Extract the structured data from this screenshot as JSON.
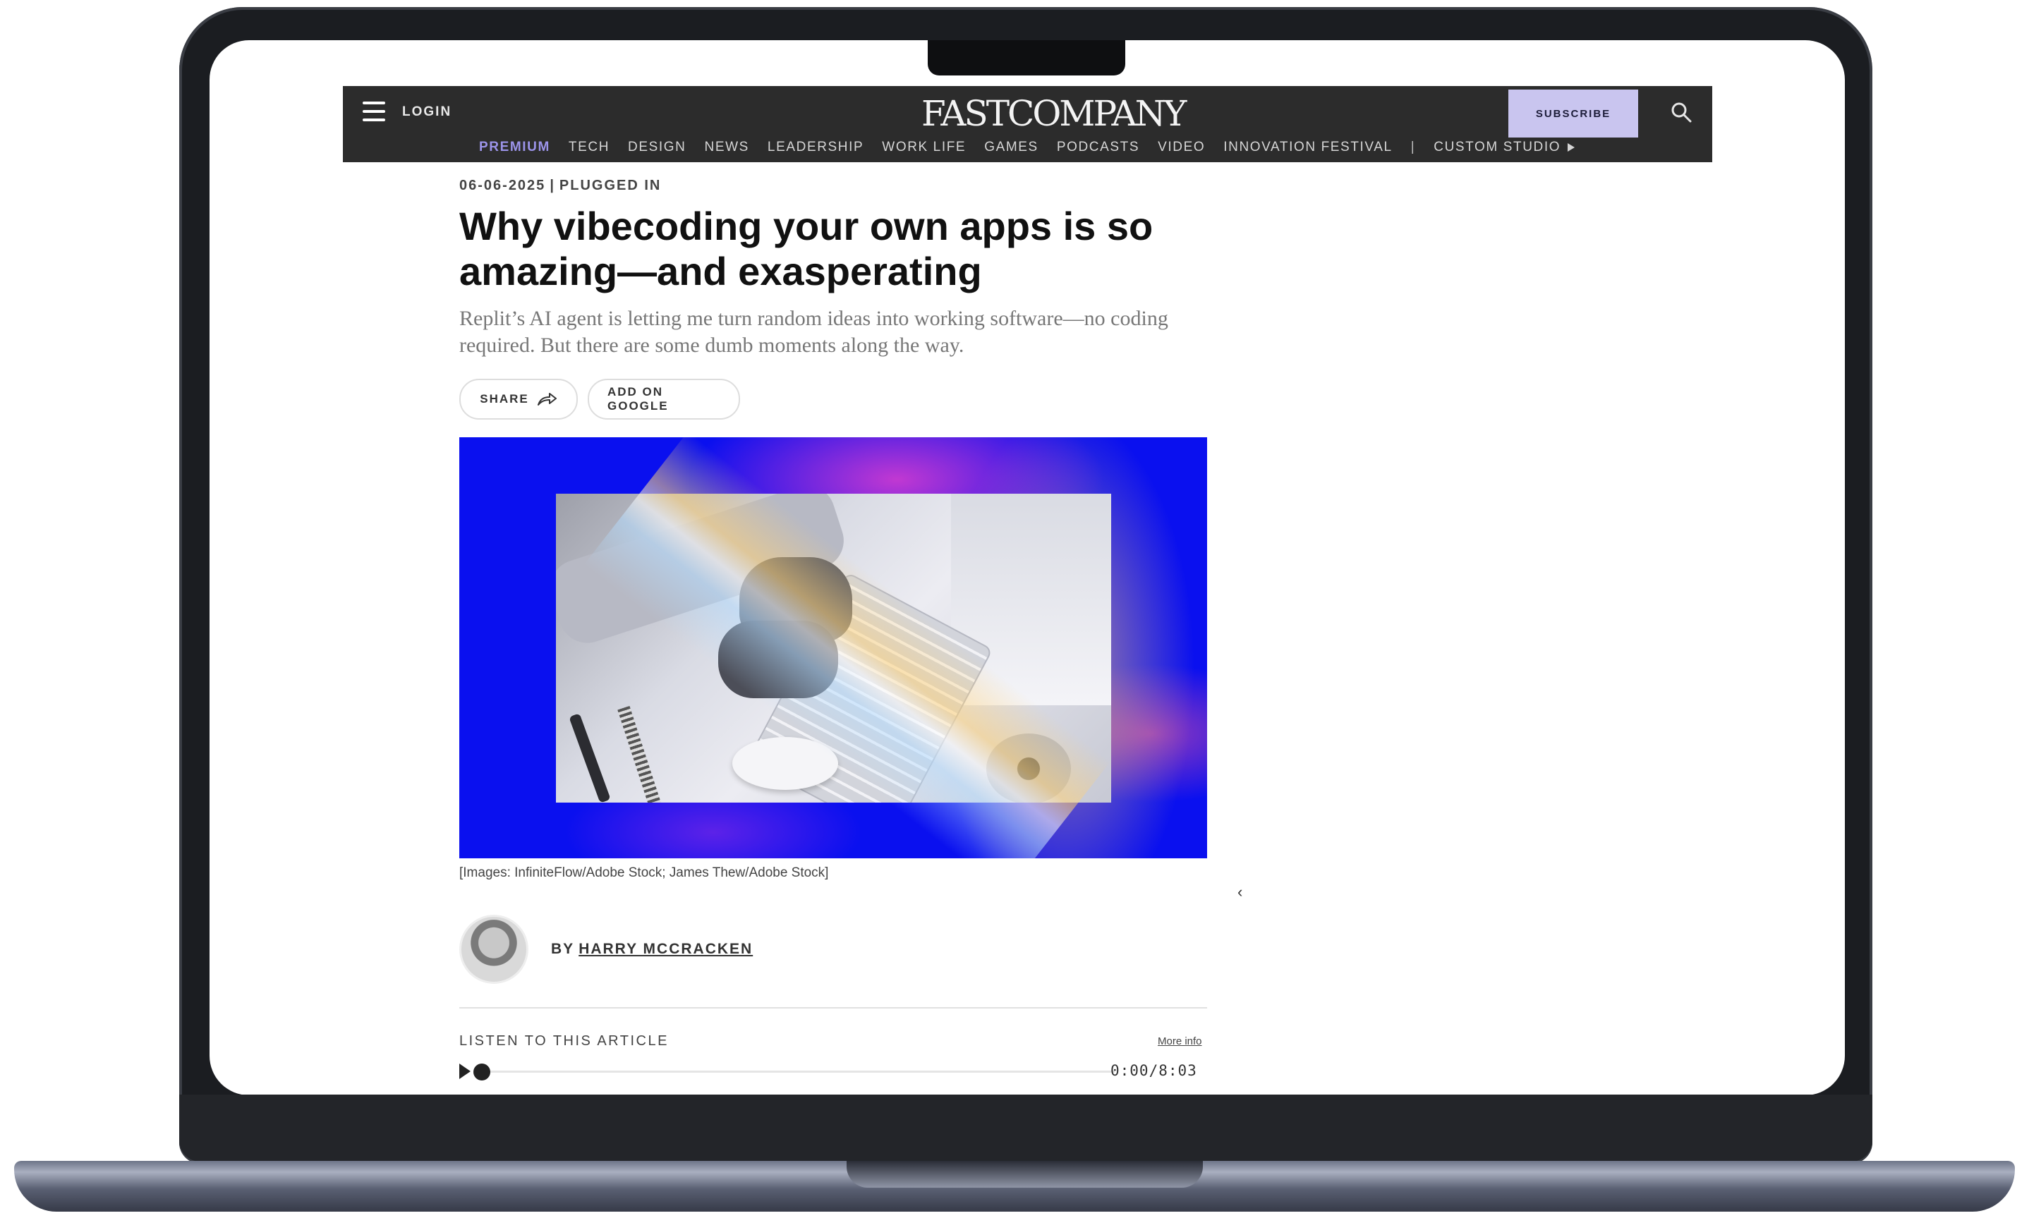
{
  "header": {
    "login_label": "LOGIN",
    "logo_text": "FASTCOMPANY",
    "subscribe_label": "SUBSCRIBE"
  },
  "nav": {
    "items": [
      "PREMIUM",
      "TECH",
      "DESIGN",
      "NEWS",
      "LEADERSHIP",
      "WORK LIFE",
      "GAMES",
      "PODCASTS",
      "VIDEO",
      "INNOVATION FESTIVAL"
    ],
    "separator": "|",
    "custom_studio": "CUSTOM STUDIO"
  },
  "article": {
    "date": "06-06-2025",
    "separator": "|",
    "section": "PLUGGED IN",
    "headline": "Why vibecoding your own apps is so amazing—and exasperating",
    "dek": "Replit’s AI agent is letting me turn random ideas into working software—no coding required. But there are some dumb moments along the way.",
    "share_label": "SHARE",
    "google_label": "ADD ON GOOGLE",
    "caption": "[Images: InfiniteFlow/Adobe Stock; James Thew/Adobe Stock]",
    "byline_prefix": "BY",
    "author": "HARRY MCCRACKEN"
  },
  "audio": {
    "label": "LISTEN TO THIS ARTICLE",
    "more_info": "More info",
    "time": "0:00/8:03",
    "progress": 0
  },
  "colors": {
    "masthead": "#2c2c2c",
    "premium": "#9c94ea",
    "subscribe_bg": "#c9c5ef",
    "hero_bg": "#0a10ef"
  }
}
